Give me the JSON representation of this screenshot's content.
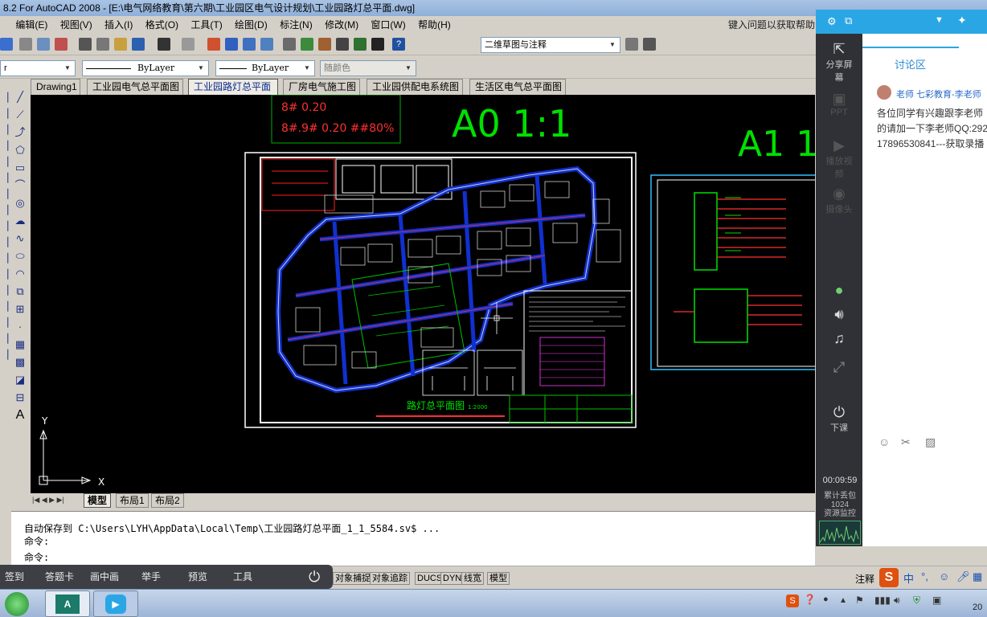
{
  "window": {
    "title": "8.2 For AutoCAD 2008 - [E:\\电气网络教育\\第六期\\工业园区电气设计规划\\工业园路灯总平面.dwg]"
  },
  "menu": [
    "编辑(E)",
    "视图(V)",
    "插入(I)",
    "格式(O)",
    "工具(T)",
    "绘图(D)",
    "标注(N)",
    "修改(M)",
    "窗口(W)",
    "帮助(H)"
  ],
  "help_search": "键入问题以获取帮助",
  "toolbar": {
    "workspace": "二维草图与注释",
    "layer": "r",
    "linetype": "ByLayer",
    "lineweight": "ByLayer",
    "color": "随颜色"
  },
  "drawing_tabs": [
    {
      "label": "Drawing1",
      "active": false
    },
    {
      "label": "工业园电气总平面图",
      "active": false
    },
    {
      "label": "工业园路灯总平面",
      "active": true
    },
    {
      "label": "厂房电气施工图",
      "active": false
    },
    {
      "label": "工业园供配电系统图",
      "active": false
    },
    {
      "label": "生活区电气总平面图",
      "active": false
    }
  ],
  "canvas": {
    "text_1": "8# 0.20",
    "text_2": "8#.9# 0.20  ##80%",
    "scale_a0": "A0  1:1",
    "scale_a1": "A1  1",
    "plan_title": "路灯总平面图",
    "plan_scale": "1:2000",
    "axis_y": "Y",
    "axis_x": "X"
  },
  "layout_tabs": [
    "模型",
    "布局1",
    "布局2"
  ],
  "command_lines": [
    "自动保存到 C:\\Users\\LYH\\AppData\\Local\\Temp\\工业园路灯总平面_1_1_5584.sv$ ...",
    "命令:",
    "命令:"
  ],
  "status_buttons": [
    "对象捕捉",
    "对象追踪",
    "DUCS",
    "DYN",
    "线宽",
    "模型"
  ],
  "annotation_scale": "注释",
  "classbar": [
    "签到",
    "答题卡",
    "画中画",
    "举手",
    "预览",
    "工具"
  ],
  "panel": {
    "tab": "讨论区",
    "side_items": [
      {
        "label": "分享屏幕",
        "icon": "share-screen-icon",
        "active": true
      },
      {
        "label": "PPT",
        "icon": "ppt-icon",
        "active": false
      },
      {
        "label": "播放视频",
        "icon": "video-icon",
        "active": false
      },
      {
        "label": "摄像头",
        "icon": "camera-icon",
        "active": false
      },
      {
        "label": "下课",
        "icon": "end-class-icon",
        "active": true
      }
    ],
    "timer": "00:09:59",
    "stats_line1": "累计丢包",
    "stats_line2": "1024",
    "stats_line3": "资源监控",
    "chat_name": "老师  七彩教育-李老师",
    "chat_text_1": "各位同学有兴趣跟李老师",
    "chat_text_2": "的请加一下李老师QQ:292",
    "chat_text_3": "17896530841---获取录播"
  },
  "tray": {
    "ime": "中",
    "clock": "20"
  },
  "colors": {
    "accent": "#2aa6e5",
    "canvas": "#000000",
    "green_text": "#00e000",
    "cad_blue": "#1030d0"
  }
}
